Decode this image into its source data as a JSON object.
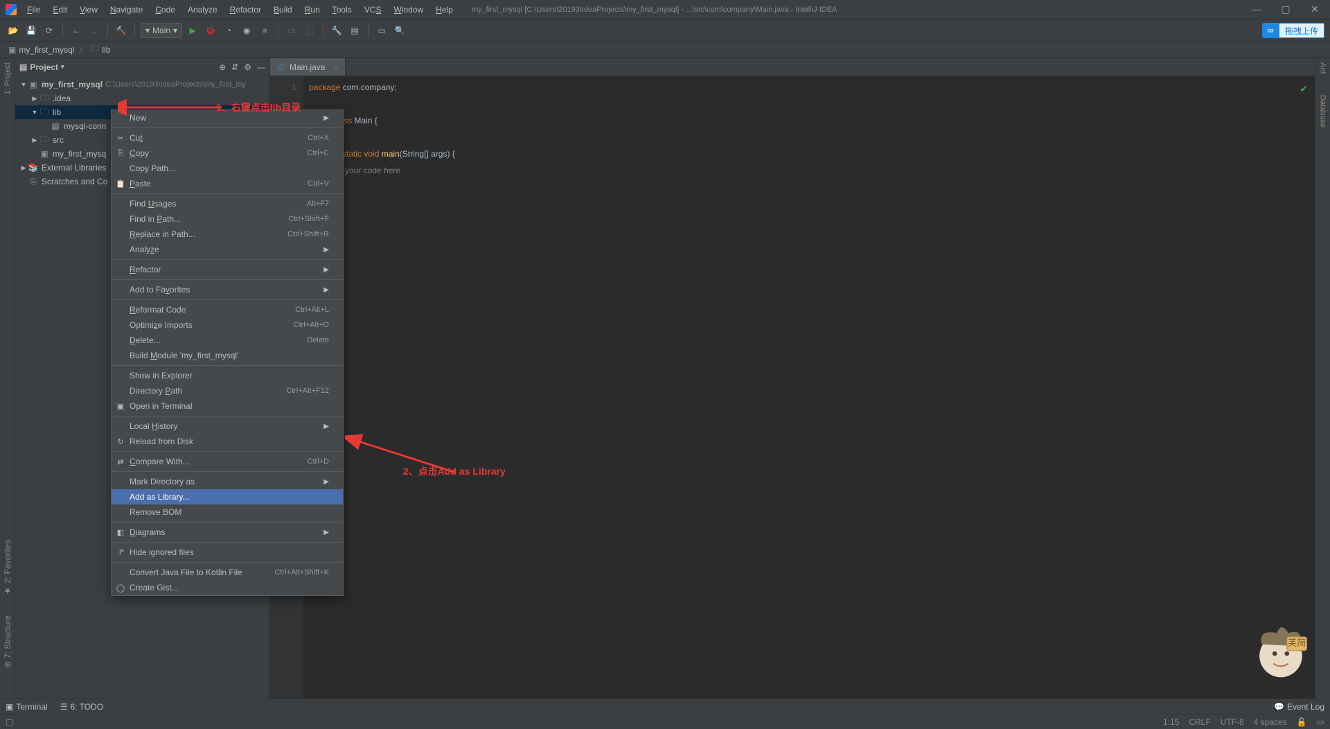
{
  "menubar": [
    "File",
    "Edit",
    "View",
    "Navigate",
    "Code",
    "Analyze",
    "Refactor",
    "Build",
    "Run",
    "Tools",
    "VCS",
    "Window",
    "Help"
  ],
  "menubar_accel": [
    "F",
    "E",
    "V",
    "N",
    "C",
    "",
    "R",
    "B",
    "R",
    "T",
    "S",
    "W",
    "H"
  ],
  "title": "my_first_mysql [C:\\Users\\20193\\IdeaProjects\\my_first_mysql] - ...\\src\\com\\company\\Main.java - IntelliJ IDEA",
  "upload_btn": "拖拽上传",
  "run_config": "Main",
  "breadcrumbs": [
    {
      "icon": "module",
      "label": "my_first_mysql"
    },
    {
      "icon": "folder",
      "label": "lib"
    }
  ],
  "left_tools": [
    "1: Project",
    "2: Favorites",
    "7: Structure"
  ],
  "right_tools": [
    "Ant",
    "Database"
  ],
  "project_header": "Project",
  "tree": [
    {
      "d": 1,
      "tw": "▼",
      "icon": "module",
      "label": "my_first_mysql",
      "path": "C:\\Users\\20193\\IdeaProjects\\my_first_my"
    },
    {
      "d": 2,
      "tw": "▶",
      "icon": "folder",
      "label": ".idea"
    },
    {
      "d": 2,
      "tw": "▼",
      "icon": "folder",
      "label": "lib",
      "sel": true
    },
    {
      "d": 3,
      "tw": "",
      "icon": "jar",
      "label": "mysql-conn"
    },
    {
      "d": 2,
      "tw": "▶",
      "icon": "src",
      "label": "src"
    },
    {
      "d": 2,
      "tw": "",
      "icon": "iml",
      "label": "my_first_mysq"
    },
    {
      "d": 1,
      "tw": "▶",
      "icon": "lib",
      "label": "External Libraries"
    },
    {
      "d": 1,
      "tw": "",
      "icon": "scratch",
      "label": "Scratches and Co"
    }
  ],
  "tab": {
    "label": "Main.java"
  },
  "code": {
    "l1_kw": "package",
    "l1_rest": " com.",
    "l1_pkg": "company",
    "l1_end": ";",
    "l3_kw": "public class ",
    "l3_name": "Main",
    "l3_end": " {",
    "l5_pre": "    ",
    "l5_kw": "public static void ",
    "l5_fn": "main",
    "l5_args": "(String[] args) {",
    "l6_pre": "    ",
    "l6_cmt": "// write your code here",
    "l7": "    }",
    "l8": "}"
  },
  "line_num_1": "1",
  "context_menu": [
    {
      "t": "New",
      "sub": true
    },
    {
      "sep": true
    },
    {
      "ico": "✂",
      "t": "Cut",
      "sc": "Ctrl+X",
      "u": "t"
    },
    {
      "ico": "⎘",
      "t": "Copy",
      "sc": "Ctrl+C",
      "u": "C"
    },
    {
      "t": "Copy Path...",
      "u": ""
    },
    {
      "ico": "📋",
      "t": "Paste",
      "sc": "Ctrl+V",
      "u": "P"
    },
    {
      "sep": true
    },
    {
      "t": "Find Usages",
      "sc": "Alt+F7",
      "u": "U"
    },
    {
      "t": "Find in Path...",
      "sc": "Ctrl+Shift+F",
      "u": "P"
    },
    {
      "t": "Replace in Path...",
      "sc": "Ctrl+Shift+R",
      "u": "R"
    },
    {
      "t": "Analyze",
      "sub": true,
      "u": "z"
    },
    {
      "sep": true
    },
    {
      "t": "Refactor",
      "sub": true,
      "u": "R"
    },
    {
      "sep": true
    },
    {
      "t": "Add to Favorites",
      "sub": true,
      "u": "v"
    },
    {
      "sep": true
    },
    {
      "t": "Reformat Code",
      "sc": "Ctrl+Alt+L",
      "u": "R"
    },
    {
      "t": "Optimize Imports",
      "sc": "Ctrl+Alt+O",
      "u": "z"
    },
    {
      "t": "Delete...",
      "sc": "Delete",
      "u": "D"
    },
    {
      "t": "Build Module 'my_first_mysql'",
      "u": "M"
    },
    {
      "sep": true
    },
    {
      "t": "Show in Explorer"
    },
    {
      "t": "Directory Path",
      "sc": "Ctrl+Alt+F12",
      "u": "P"
    },
    {
      "ico": "▣",
      "t": "Open in Terminal"
    },
    {
      "sep": true
    },
    {
      "t": "Local History",
      "sub": true,
      "u": "H"
    },
    {
      "ico": "↻",
      "t": "Reload from Disk"
    },
    {
      "sep": true
    },
    {
      "ico": "⇄",
      "t": "Compare With...",
      "sc": "Ctrl+D",
      "u": "C"
    },
    {
      "sep": true
    },
    {
      "t": "Mark Directory as",
      "sub": true
    },
    {
      "t": "Add as Library...",
      "hl": true
    },
    {
      "t": "Remove BOM"
    },
    {
      "sep": true
    },
    {
      "ico": "◧",
      "t": "Diagrams",
      "sub": true,
      "u": "D"
    },
    {
      "sep": true
    },
    {
      "ico": ".i*",
      "t": "Hide ignored files"
    },
    {
      "sep": true
    },
    {
      "t": "Convert Java File to Kotlin File",
      "sc": "Ctrl+Alt+Shift+K"
    },
    {
      "ico": "◯",
      "t": "Create Gist..."
    }
  ],
  "annotations": {
    "a1": "1、右键点击lib目录",
    "a2": "2、点击Add as Library"
  },
  "bottom_tabs": {
    "terminal": "Terminal",
    "todo": "6: TODO",
    "event_log": "Event Log"
  },
  "status": {
    "pos": "1:15",
    "eol": "CRLF",
    "enc": "UTF-8",
    "indent": "4 spaces",
    "readonly": "⎆"
  }
}
